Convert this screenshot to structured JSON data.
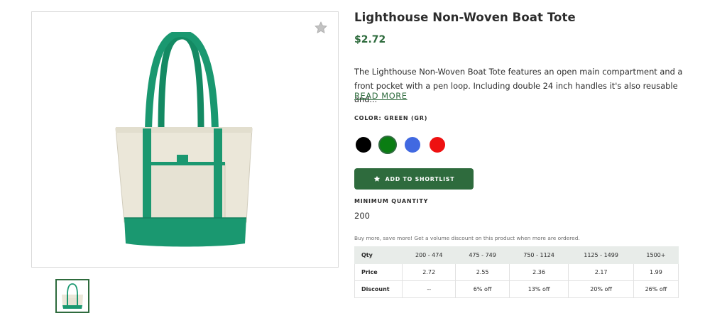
{
  "product": {
    "title": "Lighthouse Non-Woven Boat Tote",
    "price": "$2.72",
    "description": "The Lighthouse Non-Woven Boat Tote features an open main compartment and a front pocket with a pen loop. Including double 24 inch handles it's also reusable and...",
    "read_more": "READ MORE",
    "color_label": "COLOR: GREEN (GR)",
    "colors": [
      {
        "name": "black",
        "hex": "#000000",
        "selected": false
      },
      {
        "name": "green",
        "hex": "#0a7d12",
        "selected": true
      },
      {
        "name": "blue",
        "hex": "#4169e1",
        "selected": false
      },
      {
        "name": "red",
        "hex": "#ee1111",
        "selected": false
      }
    ],
    "shortlist_label": "ADD TO SHORTLIST",
    "min_qty_label": "MINIMUM QUANTITY",
    "min_qty_value": "200",
    "volume_note": "Buy more, save more! Get a volume discount on this product when more are ordered."
  },
  "pricing_table": {
    "headers": [
      "Qty",
      "200 - 474",
      "475 - 749",
      "750 - 1124",
      "1125 - 1499",
      "1500+"
    ],
    "rows": [
      {
        "label": "Price",
        "cells": [
          "2.72",
          "2.55",
          "2.36",
          "2.17",
          "1.99"
        ]
      },
      {
        "label": "Discount",
        "cells": [
          "--",
          "6% off",
          "13% off",
          "20% off",
          "26% off"
        ]
      }
    ]
  },
  "icons": {
    "favorite": "star-icon",
    "shortlist": "star-icon"
  },
  "colors": {
    "brand_green": "#2e6b3d",
    "tote_green": "#1a9870",
    "tote_canvas": "#ebe7d9"
  }
}
